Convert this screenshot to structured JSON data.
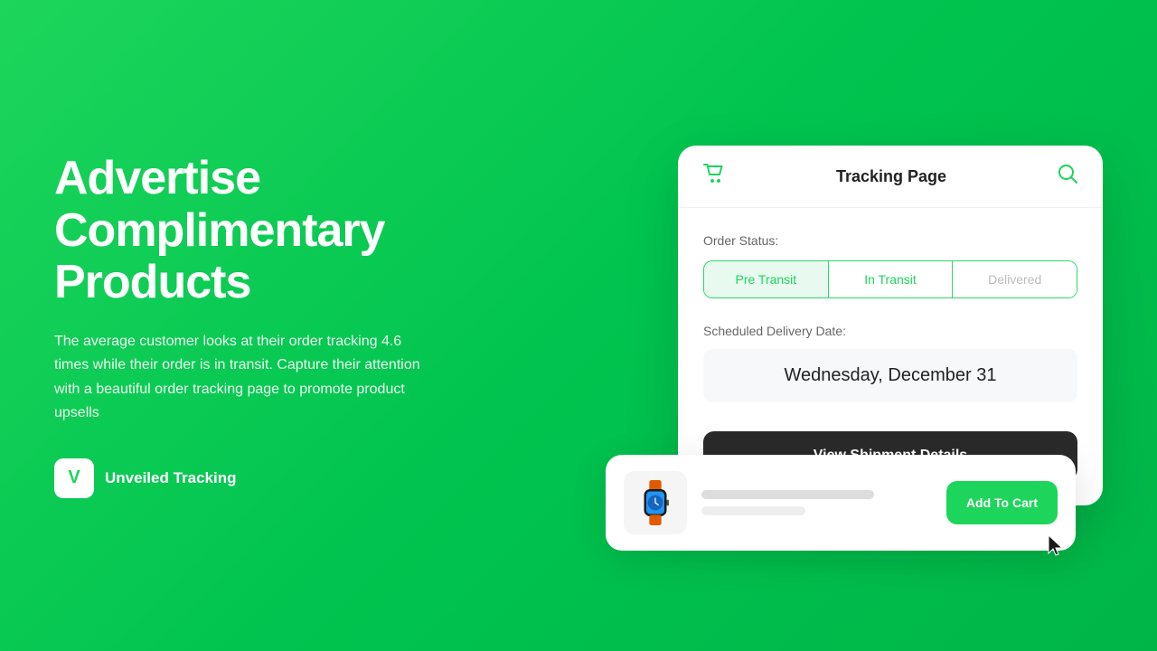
{
  "left": {
    "headline": "Advertise Complimentary Products",
    "description": "The average customer looks at their order tracking 4.6 times while their order is in transit. Capture their attention with a beautiful order tracking page to promote product upsells",
    "brand_logo": "V",
    "brand_name": "Unveiled Tracking"
  },
  "tracking_card": {
    "title": "Tracking Page",
    "order_status_label": "Order Status:",
    "tabs": [
      {
        "label": "Pre Transit",
        "state": "active"
      },
      {
        "label": "In Transit",
        "state": "semi-active"
      },
      {
        "label": "Delivered",
        "state": "inactive"
      }
    ],
    "delivery_label": "Scheduled Delivery Date:",
    "delivery_date": "Wednesday, December 31",
    "view_shipment_btn": "View Shipment Details"
  },
  "upsell": {
    "add_to_cart_label": "Add To Cart"
  }
}
